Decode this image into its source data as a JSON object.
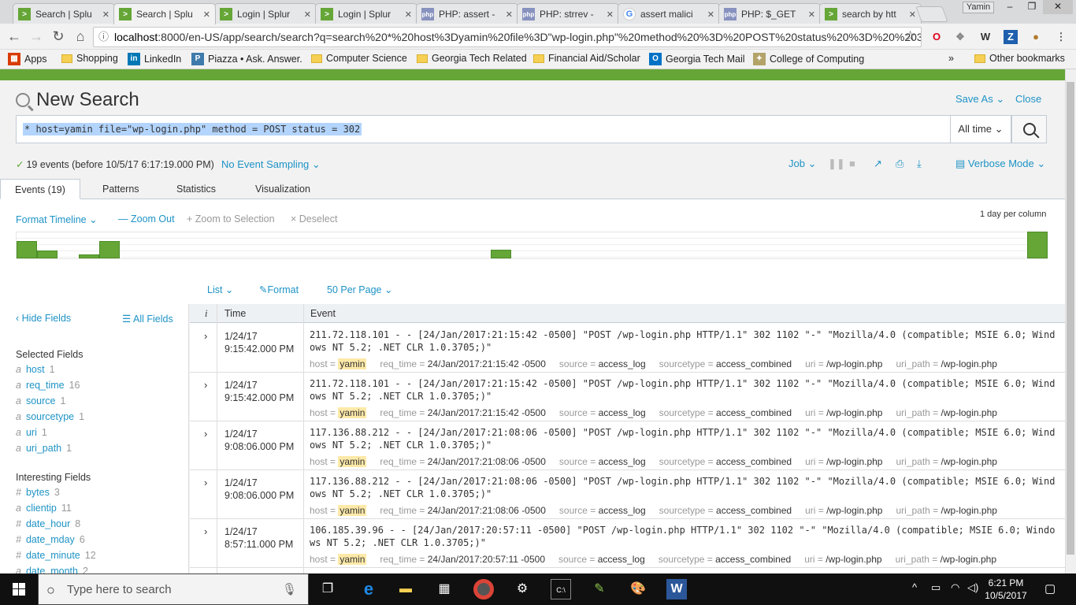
{
  "browser": {
    "tabs": [
      {
        "title": "Search | Splu",
        "icon": "splunk",
        "active": false
      },
      {
        "title": "Search | Splu",
        "icon": "splunk",
        "active": true
      },
      {
        "title": "Login | Splur",
        "icon": "splunk",
        "active": false
      },
      {
        "title": "Login | Splur",
        "icon": "splunk",
        "active": false
      },
      {
        "title": "PHP: assert -",
        "icon": "php",
        "active": false
      },
      {
        "title": "PHP: strrev -",
        "icon": "php",
        "active": false
      },
      {
        "title": "assert malici",
        "icon": "google",
        "active": false
      },
      {
        "title": "PHP: $_GET",
        "icon": "php",
        "active": false
      },
      {
        "title": "search by htt",
        "icon": "splunk",
        "active": false
      }
    ],
    "user": "Yamin",
    "url_host": "localhost",
    "url_rest": ":8000/en-US/app/search/search?q=search%20*%20host%3Dyamin%20file%3D\"wp-login.php\"%20method%20%3D%20POST%20status%20%3D%20%203...",
    "bookmarks": [
      {
        "label": "Apps",
        "icon": "apps"
      },
      {
        "label": "Shopping",
        "icon": "folder"
      },
      {
        "label": "LinkedIn",
        "icon": "linkedin"
      },
      {
        "label": "Piazza • Ask. Answer.",
        "icon": "piazza"
      },
      {
        "label": "Computer Science",
        "icon": "folder"
      },
      {
        "label": "Georgia Tech Related",
        "icon": "folder"
      },
      {
        "label": "Financial Aid/Scholar",
        "icon": "folder"
      },
      {
        "label": "Georgia Tech Mail",
        "icon": "outlook"
      },
      {
        "label": "College of Computing",
        "icon": "gt"
      }
    ],
    "more_bookmarks": "»",
    "other_bookmarks": "Other bookmarks"
  },
  "splunk": {
    "title": "New Search",
    "save_as": "Save As",
    "close": "Close",
    "query": "* host=yamin file=\"wp-login.php\" method = POST status = 302",
    "time_range": "All time",
    "status_text": "19 events (before 10/5/17 6:17:19.000 PM)",
    "sampling": "No Event Sampling",
    "job": "Job",
    "mode": "Verbose Mode",
    "tabs": [
      "Events (19)",
      "Patterns",
      "Statistics",
      "Visualization"
    ],
    "timeline": {
      "format": "Format Timeline",
      "zoom_out": "Zoom Out",
      "zoom_sel": "Zoom to Selection",
      "deselect": "Deselect",
      "scale": "1 day per column"
    },
    "list_controls": {
      "list": "List",
      "format": "Format",
      "per_page": "50 Per Page"
    },
    "fields": {
      "hide": "Hide Fields",
      "all": "All Fields",
      "selected_head": "Selected Fields",
      "selected": [
        {
          "type": "a",
          "name": "host",
          "count": "1"
        },
        {
          "type": "a",
          "name": "req_time",
          "count": "16"
        },
        {
          "type": "a",
          "name": "source",
          "count": "1"
        },
        {
          "type": "a",
          "name": "sourcetype",
          "count": "1"
        },
        {
          "type": "a",
          "name": "uri",
          "count": "1"
        },
        {
          "type": "a",
          "name": "uri_path",
          "count": "1"
        }
      ],
      "interesting_head": "Interesting Fields",
      "interesting": [
        {
          "type": "#",
          "name": "bytes",
          "count": "3"
        },
        {
          "type": "a",
          "name": "clientip",
          "count": "11"
        },
        {
          "type": "#",
          "name": "date_hour",
          "count": "8"
        },
        {
          "type": "#",
          "name": "date_mday",
          "count": "6"
        },
        {
          "type": "#",
          "name": "date_minute",
          "count": "12"
        },
        {
          "type": "a",
          "name": "date_month",
          "count": "2"
        }
      ]
    },
    "table_head": {
      "i": "i",
      "time": "Time",
      "event": "Event"
    },
    "events": [
      {
        "date": "1/24/17",
        "time": "9:15:42.000 PM",
        "raw": "211.72.118.101 - - [24/Jan/2017:21:15:42 -0500] \"POST /wp-login.php HTTP/1.1\" 302 1102 \"-\" \"Mozilla/4.0 (compatible; MSIE 6.0; Windows NT 5.2; .NET CLR 1.0.3705;)\"",
        "req_time": "24/Jan/2017:21:15:42 -0500"
      },
      {
        "date": "1/24/17",
        "time": "9:15:42.000 PM",
        "raw": "211.72.118.101 - - [24/Jan/2017:21:15:42 -0500] \"POST /wp-login.php HTTP/1.1\" 302 1102 \"-\" \"Mozilla/4.0 (compatible; MSIE 6.0; Windows NT 5.2; .NET CLR 1.0.3705;)\"",
        "req_time": "24/Jan/2017:21:15:42 -0500"
      },
      {
        "date": "1/24/17",
        "time": "9:08:06.000 PM",
        "raw": "117.136.88.212 - - [24/Jan/2017:21:08:06 -0500] \"POST /wp-login.php HTTP/1.1\" 302 1102 \"-\" \"Mozilla/4.0 (compatible; MSIE 6.0; Windows NT 5.2; .NET CLR 1.0.3705;)\"",
        "req_time": "24/Jan/2017:21:08:06 -0500"
      },
      {
        "date": "1/24/17",
        "time": "9:08:06.000 PM",
        "raw": "117.136.88.212 - - [24/Jan/2017:21:08:06 -0500] \"POST /wp-login.php HTTP/1.1\" 302 1102 \"-\" \"Mozilla/4.0 (compatible; MSIE 6.0; Windows NT 5.2; .NET CLR 1.0.3705;)\"",
        "req_time": "24/Jan/2017:21:08:06 -0500"
      },
      {
        "date": "1/24/17",
        "time": "8:57:11.000 PM",
        "raw": "106.185.39.96 - - [24/Jan/2017:20:57:11 -0500] \"POST /wp-login.php HTTP/1.1\" 302 1102 \"-\" \"Mozilla/4.0 (compatible; MSIE 6.0; Windows NT 5.2; .NET CLR 1.0.3705;)\"",
        "req_time": "24/Jan/2017:20:57:11 -0500"
      }
    ],
    "kv_common": {
      "host_k": "host = ",
      "host_v": "yamin",
      "req_k": "req_time = ",
      "source_k": "source = ",
      "source_v": "access_log",
      "st_k": "sourcetype = ",
      "st_v": "access_combined",
      "uri_k": "uri = ",
      "uri_v": "/wp-login.php",
      "up_k": "uri_path = ",
      "up_v": "/wp-login.php"
    }
  },
  "taskbar": {
    "search_placeholder": "Type here to search",
    "time": "6:21 PM",
    "date": "10/5/2017"
  },
  "colors": {
    "accent": "#65a637",
    "link": "#1e93c6",
    "highlight": "#fde9a8"
  }
}
